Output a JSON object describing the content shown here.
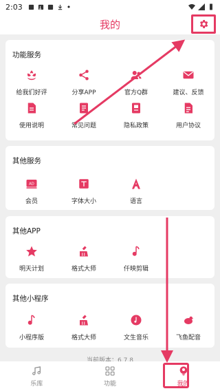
{
  "status_bar": {
    "time": "2:03",
    "dot": "•"
  },
  "header": {
    "title": "我的",
    "settings_icon": "gear-icon"
  },
  "accent_color": "#e53a63",
  "sections": [
    {
      "title": "功能服务",
      "items": [
        {
          "label": "给我们好评",
          "icon": "flower-icon"
        },
        {
          "label": "分享APP",
          "icon": "share-icon"
        },
        {
          "label": "官方Q群",
          "icon": "group-icon"
        },
        {
          "label": "建议、反馈",
          "icon": "mail-icon"
        },
        {
          "label": "使用说明",
          "icon": "document-icon"
        },
        {
          "label": "常见问题",
          "icon": "faq-icon"
        },
        {
          "label": "隐私政策",
          "icon": "privacy-icon"
        },
        {
          "label": "用户协议",
          "icon": "agreement-icon"
        }
      ]
    },
    {
      "title": "其他服务",
      "items": [
        {
          "label": "会员",
          "icon": "ad-icon"
        },
        {
          "label": "字体大小",
          "icon": "font-size-icon"
        },
        {
          "label": "语言",
          "icon": "language-icon"
        }
      ]
    },
    {
      "title": "其他APP",
      "items": [
        {
          "label": "明天计划",
          "icon": "star-icon"
        },
        {
          "label": "格式大师",
          "icon": "brush-icon"
        },
        {
          "label": "仟映剪辑",
          "icon": "music-note-icon"
        }
      ]
    },
    {
      "title": "其他小程序",
      "items": [
        {
          "label": "小程序版",
          "icon": "music-note-icon"
        },
        {
          "label": "格式大师",
          "icon": "brush-icon"
        },
        {
          "label": "文生音乐",
          "icon": "music-disc-icon"
        },
        {
          "label": "飞鱼配音",
          "icon": "bird-icon"
        }
      ]
    }
  ],
  "version_text": "当前版本：6.7.8",
  "tabbar": [
    {
      "label": "乐库",
      "icon": "music-library-icon",
      "active": false
    },
    {
      "label": "功能",
      "icon": "grid-icon",
      "active": false
    },
    {
      "label": "我的",
      "icon": "profile-icon",
      "active": true
    }
  ]
}
